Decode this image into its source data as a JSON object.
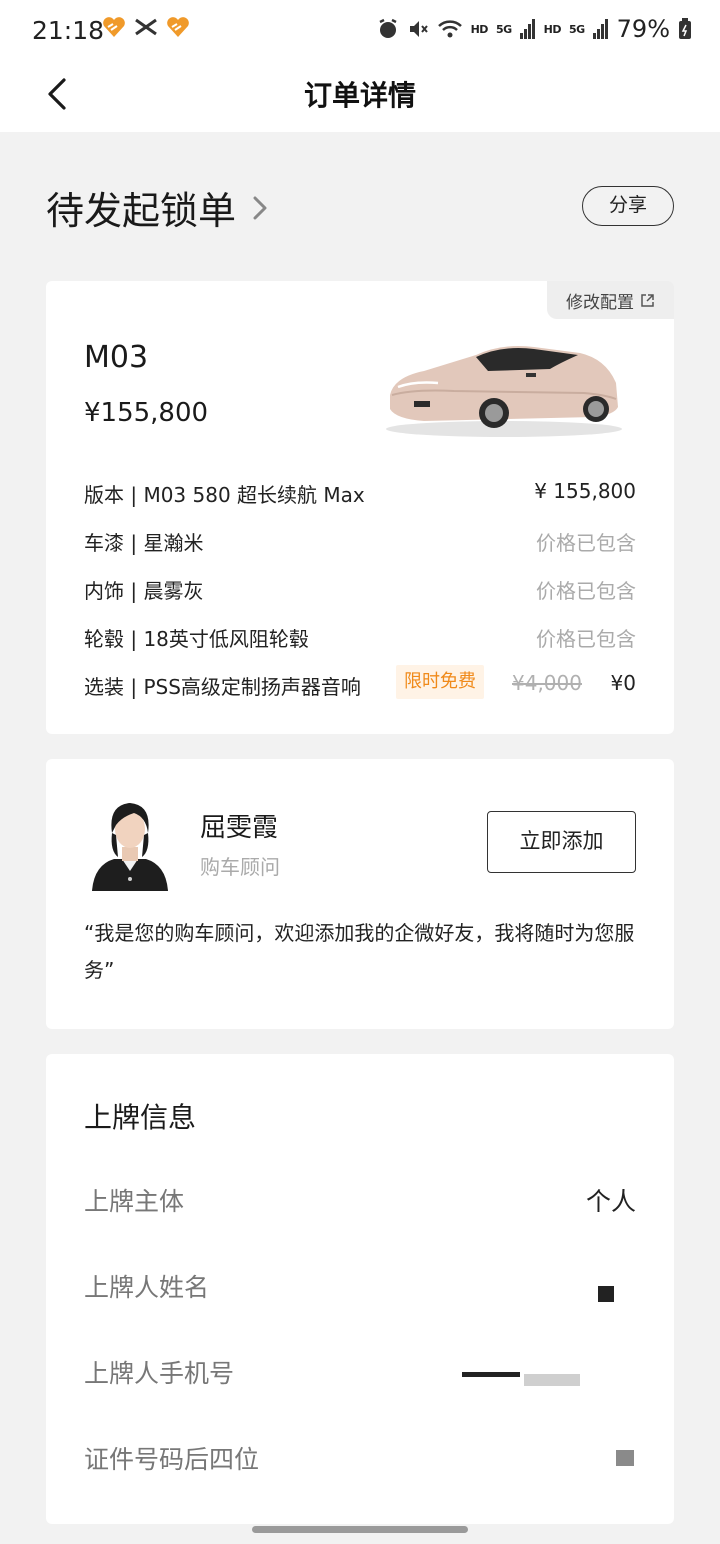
{
  "status_bar": {
    "time": "21:18",
    "hd1": "HD",
    "net1": "5G",
    "hd2": "HD",
    "net2": "5G",
    "battery": "79%"
  },
  "nav": {
    "title": "订单详情",
    "back_icon": "chevron-left-icon"
  },
  "order": {
    "status": "待发起锁单",
    "share_label": "分享"
  },
  "car": {
    "modify_label": "修改配置",
    "model": "M03",
    "price": "¥155,800",
    "specs": [
      {
        "label": "版本 | M03 580 超长续航 Max",
        "value": "¥ 155,800"
      },
      {
        "label": "车漆 | 星瀚米",
        "value": "价格已包含"
      },
      {
        "label": "内饰 | 晨雾灰",
        "value": "价格已包含"
      },
      {
        "label": "轮毂 | 18英寸低风阻轮毂",
        "value": "价格已包含"
      }
    ],
    "option": {
      "label": "选装 | PSS高级定制扬声器音响",
      "badge": "限时免费",
      "original_price": "¥4,000",
      "final_price": "¥0"
    }
  },
  "advisor": {
    "name": "屈雯霞",
    "role": "购车顾问",
    "add_label": "立即添加",
    "quote": "“我是您的购车顾问，欢迎添加我的企微好友，我将随时为您服务”"
  },
  "plate": {
    "title": "上牌信息",
    "rows": [
      {
        "label": "上牌主体",
        "value": "个人"
      },
      {
        "label": "上牌人姓名",
        "value": ""
      },
      {
        "label": "上牌人手机号",
        "value": ""
      },
      {
        "label": "证件号码后四位",
        "value": ""
      }
    ]
  },
  "colors": {
    "accent_orange": "#f08a1a",
    "badge_bg": "#fff3e6",
    "muted_text": "#aaaaaa",
    "page_bg": "#f2f2f2"
  }
}
